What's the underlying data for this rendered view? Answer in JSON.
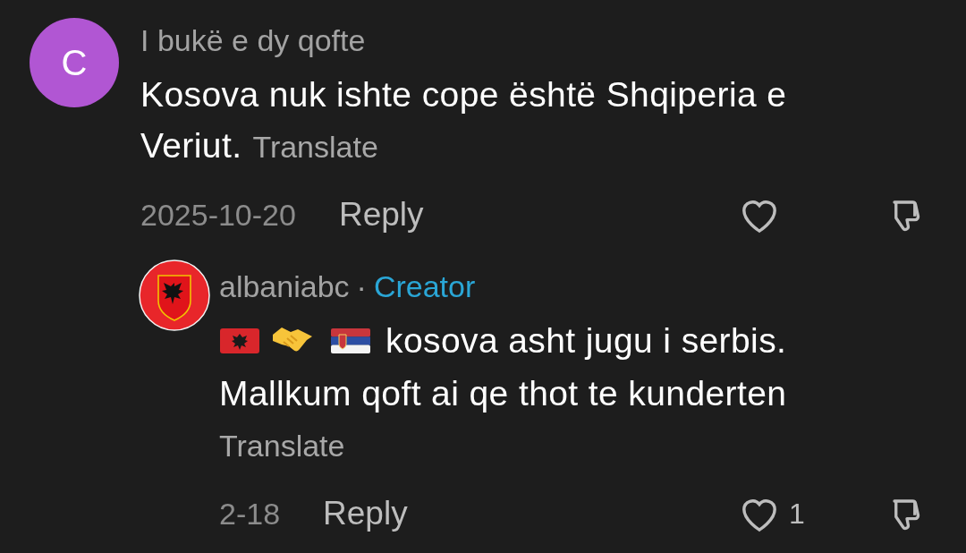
{
  "comments": [
    {
      "avatar": {
        "kind": "letter",
        "letter": "C",
        "color": "#b156d3"
      },
      "author": "I bukë e dy qofte",
      "text_lines": [
        "Kosova nuk ishte cope është Shqiperia e",
        "Veriut."
      ],
      "translate": "Translate",
      "date": "2025-10-20",
      "reply": "Reply",
      "liked": false,
      "replies": [
        {
          "avatar": {
            "kind": "emblem"
          },
          "author": "albaniabc",
          "separator": "·",
          "badge": "Creator",
          "prefix_icons": [
            {
              "kind": "albania_flag"
            },
            {
              "kind": "handshake"
            },
            {
              "kind": "serbia_flag"
            }
          ],
          "text_lines": [
            "kosova asht jugu i serbis.",
            "Mallkum qoft ai qe thot te kunderten"
          ],
          "translate": "Translate",
          "date": "2-18",
          "reply": "Reply",
          "liked": false,
          "likes": "1"
        }
      ]
    }
  ]
}
